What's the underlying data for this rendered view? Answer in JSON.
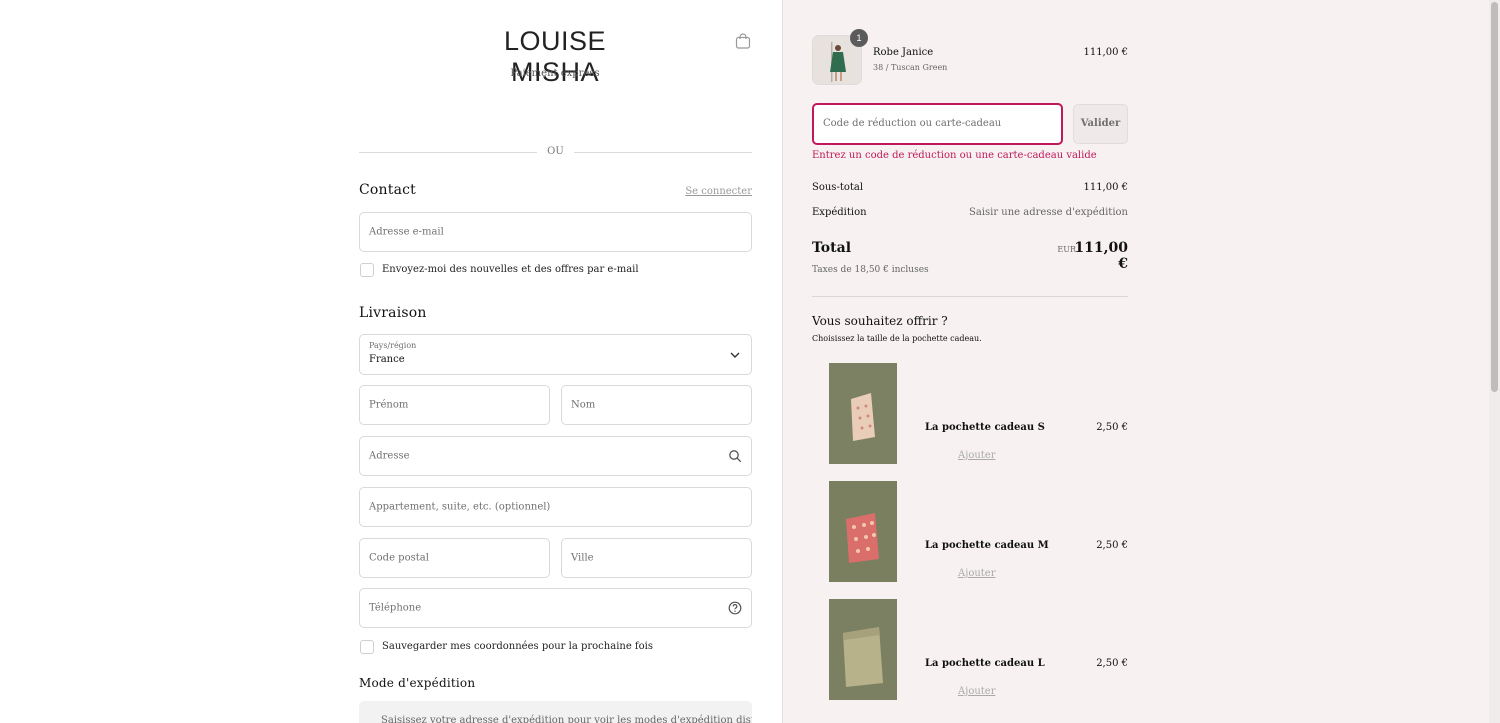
{
  "header": {
    "brand": "LOUISE MISHA",
    "express_label": "Paiement express",
    "cart_icon": "shopping-bag-icon"
  },
  "divider_text": "OU",
  "contact": {
    "title": "Contact",
    "login_link": "Se connecter",
    "email_placeholder": "Adresse e-mail",
    "newsletter_label": "Envoyez-moi des nouvelles et des offres par e-mail"
  },
  "delivery": {
    "title": "Livraison",
    "country_label": "Pays/région",
    "country_value": "France",
    "firstname_placeholder": "Prénom",
    "lastname_placeholder": "Nom",
    "address_placeholder": "Adresse",
    "apartment_placeholder": "Appartement, suite, etc. (optionnel)",
    "postal_placeholder": "Code postal",
    "city_placeholder": "Ville",
    "phone_placeholder": "Téléphone",
    "save_label": "Sauvegarder mes coordonnées pour la prochaine fois"
  },
  "shipping_method": {
    "title": "Mode d'expédition",
    "info": "Saisissez votre adresse d'expédition pour voir les modes d'expédition disponibles."
  },
  "order": {
    "product": {
      "quantity": "1",
      "name": "Robe Janice",
      "variant": "38 / Tuscan Green",
      "price": "111,00 €"
    },
    "discount_placeholder": "Code de réduction ou carte-cadeau",
    "validate_label": "Valider",
    "error": "Entrez un code de réduction ou une carte-cadeau valide",
    "subtotal_label": "Sous-total",
    "subtotal_value": "111,00 €",
    "shipping_label": "Expédition",
    "shipping_value": "Saisir une adresse d'expédition",
    "total_label": "Total",
    "total_currency": "EUR",
    "total_value": "111,00 €",
    "taxes": "Taxes de 18,50 € incluses"
  },
  "gift": {
    "title": "Vous souhaitez offrir ?",
    "subtitle": "Choisissez la taille de la pochette cadeau.",
    "items": [
      {
        "name": "La pochette cadeau S",
        "price": "2,50 €",
        "add": "Ajouter"
      },
      {
        "name": "La pochette cadeau M",
        "price": "2,50 €",
        "add": "Ajouter"
      },
      {
        "name": "La pochette cadeau L",
        "price": "2,50 €",
        "add": "Ajouter"
      }
    ]
  },
  "colors": {
    "accent_error": "#c0195b",
    "panel_bg": "#f7f1f1"
  }
}
